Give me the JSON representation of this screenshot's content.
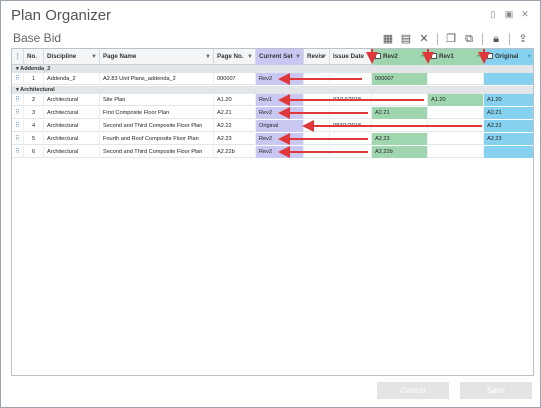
{
  "window": {
    "title": "Plan Organizer",
    "subtitle": "Base Bid"
  },
  "toolbar": {
    "icons": [
      "calendar-icon",
      "document-icon",
      "close-icon",
      "copy-icon",
      "duplicate-icon",
      "lock-icon",
      "export-icon"
    ]
  },
  "columns": {
    "no": "No.",
    "discipline": "Discipline",
    "page_name": "Page Name",
    "page_no": "Page No.",
    "current_set": "Current Set",
    "revis": "Revis",
    "issue_date": "Issue Date",
    "rev2": "Rev2",
    "rev1": "Rev1",
    "original": "Original"
  },
  "groups": [
    {
      "name": "Addenda_2",
      "rows": [
        {
          "no": "1",
          "discipline": "Addenda_2",
          "page_name": "A2.83 Unit Plans_addenda_2",
          "page_no": "000007",
          "current_set": "Rev2",
          "revis": "",
          "issue_date": "",
          "rev2": "000007",
          "rev1": "",
          "original": ""
        }
      ]
    },
    {
      "name": "Architectural",
      "rows": [
        {
          "no": "2",
          "discipline": "Architectural",
          "page_name": "Site Plan",
          "page_no": "A1.20",
          "current_set": "Rev1",
          "revis": "",
          "issue_date": "02/14/2018",
          "rev2": "",
          "rev1": "A1.20",
          "original": "A1.20"
        },
        {
          "no": "3",
          "discipline": "Architectural",
          "page_name": "First Composite Floor Plan",
          "page_no": "A2.21",
          "current_set": "Rev2",
          "revis": "",
          "issue_date": "",
          "rev2": "A2.21",
          "rev1": "",
          "original": "A2.21"
        },
        {
          "no": "4",
          "discipline": "Architectural",
          "page_name": "Second and Third Composite Floor Plan",
          "page_no": "A2.22",
          "current_set": "Original",
          "revis": "",
          "issue_date": "08/01/2018",
          "rev2": "",
          "rev1": "",
          "original": "A2.22"
        },
        {
          "no": "5",
          "discipline": "Architectural",
          "page_name": "Fourth and Roof Composite Floor Plan",
          "page_no": "A2.23",
          "current_set": "Rev2",
          "revis": "",
          "issue_date": "",
          "rev2": "A2.23",
          "rev1": "",
          "original": "A2.23"
        },
        {
          "no": "6",
          "discipline": "Architectural",
          "page_name": "Second and Third Composite Floor Plan",
          "page_no": "A2.22b",
          "current_set": "Rev2",
          "revis": "",
          "issue_date": "",
          "rev2": "A2.22b",
          "rev1": "",
          "original": ""
        }
      ]
    }
  ],
  "footer": {
    "cancel": "Cancel",
    "save": "Save"
  },
  "colors": {
    "current_set": "#c8c8f3",
    "rev_green": "#9fd6b0",
    "original_blue": "#86d1f0",
    "arrow_red": "#e0373b"
  }
}
